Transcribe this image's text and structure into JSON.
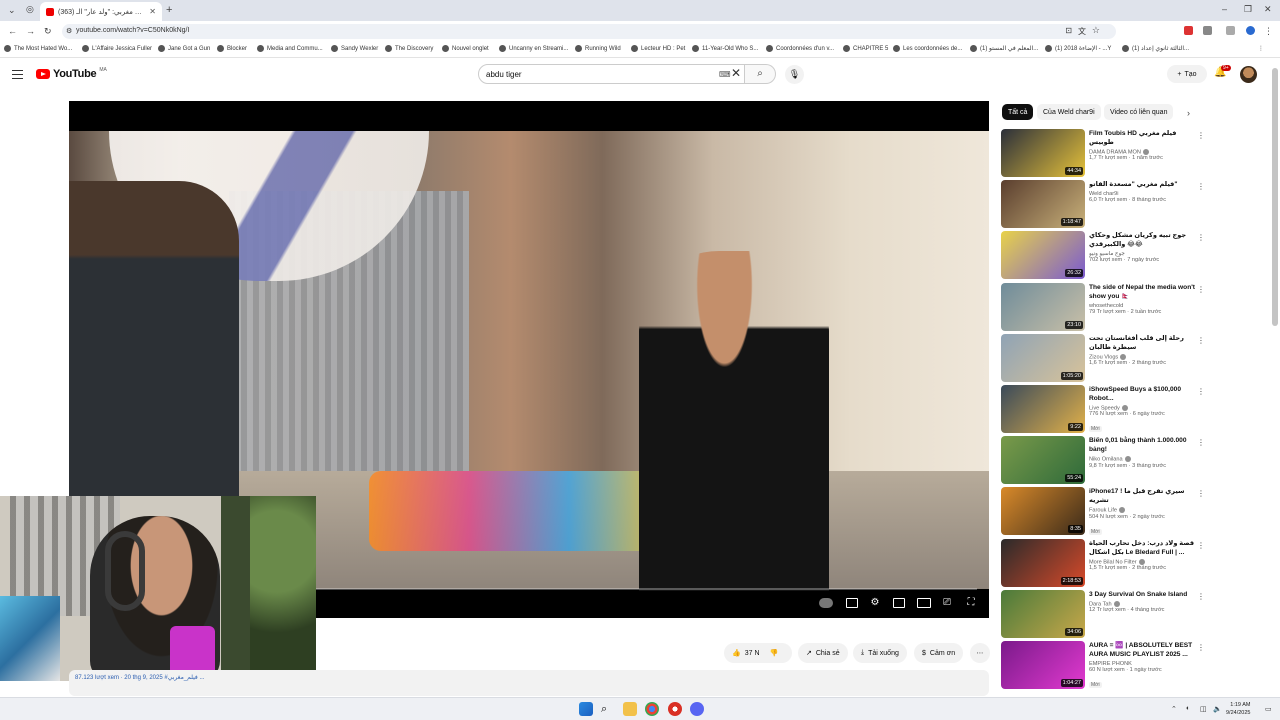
{
  "browser": {
    "tab_title": "(363) فيلم مغربي: \"ولد عار\" الـ...",
    "new_tab_symbol": "+",
    "url": "youtube.com/watch?v=C50Nk0kNg/I",
    "bookmarks": [
      "The Most Hated Wo...",
      "L'Affaire Jessica Fuller",
      "Jane Got a Gun",
      "Blocker",
      "Media and Commu...",
      "Sandy Wexler",
      "The Discovery",
      "Nouvel onglet",
      "Uncanny en Streami...",
      "Running Wild",
      "Lecteur HD : Pet",
      "11-Year-Old Who S...",
      "Coordonnées d'un v...",
      "CHAPITRE 5",
      "Les coordonnées de...",
      "(1) المعلم في المستو...",
      "(1) الإضاءة 2018 - ...Y",
      "(1) الثالثة ثانوي إعداد..."
    ]
  },
  "youtube": {
    "logo_text": "YouTube",
    "logo_country": "MA",
    "search_value": "abdu tiger",
    "create_label": "Tạo",
    "notifications_badge": "9+"
  },
  "player": {
    "progress": 0.22
  },
  "actions": {
    "likes": "37 N",
    "share": "Chia sẻ",
    "download": "Tải xuống",
    "thanks": "Cảm ơn"
  },
  "meta_strip": "87.123 lượt xem · 20 thg 9, 2025 #فيلم_مغربي ...",
  "chips": [
    "Tất cả",
    "Của Weld char9i",
    "Video có liên quan"
  ],
  "recommendations": [
    {
      "title": "Film Toubis HD فيلم مغربي طوبيس",
      "channel": "DAMA DRAMA MON",
      "verified": true,
      "stats": "1,7 Tr lượt xem · 1 năm trước",
      "duration": "44:34",
      "badge": "",
      "colors": [
        "#2b2f3a",
        "#e6c23a"
      ]
    },
    {
      "title": "فيلم مغربي \"مسعدة الفاتو\"",
      "channel": "Weld char9i",
      "verified": false,
      "stats": "6,0 Tr lượt xem · 8 tháng trước",
      "duration": "1:18:47",
      "badge": "",
      "colors": [
        "#5a3e2e",
        "#c9b17a"
      ]
    },
    {
      "title": "جوج تبيه وكريان مشكل وحكاي والكبيرقدي 😂😂",
      "channel": "جوج ماسيو ونيو",
      "verified": false,
      "stats": "702 lượt xem · 7 ngày trước",
      "duration": "26:32",
      "badge": "",
      "colors": [
        "#e8d24a",
        "#7a5ad0"
      ]
    },
    {
      "title": "The side of Nepal the media won't show you 🇳🇵",
      "channel": "whosethecold",
      "verified": false,
      "stats": "79 Tr lượt xem · 2 tuần trước",
      "duration": "23:10",
      "badge": "",
      "colors": [
        "#6f8c9a",
        "#c9c0a8"
      ]
    },
    {
      "title": "رحلة إلى قلب أفغانستان تحت سيطرة طالبان",
      "channel": "Zizou Vlogs",
      "verified": true,
      "stats": "1,6 Tr lượt xem · 2 tháng trước",
      "duration": "1:05:20",
      "badge": "",
      "colors": [
        "#8fa3b5",
        "#d8c39a"
      ]
    },
    {
      "title": "iShowSpeed Buys a $100,000 Robot...",
      "channel": "Live Speedy",
      "verified": true,
      "stats": "776 N lượt xem · 6 ngày trước",
      "duration": "9:22",
      "badge": "Mới",
      "colors": [
        "#3a4a5a",
        "#e2b14a"
      ]
    },
    {
      "title": "Biến 0,01 bằng thành 1.000.000 bảng!",
      "channel": "Niko Omilana",
      "verified": true,
      "stats": "9,8 Tr lượt xem · 3 tháng trước",
      "duration": "55:24",
      "badge": "",
      "colors": [
        "#7a9a4a",
        "#2e6a3a"
      ]
    },
    {
      "title": "iPhone17 ! سيري تفرج قبل ما تشريه",
      "channel": "Farouk Life",
      "verified": true,
      "stats": "504 N lượt xem · 2 ngày trước",
      "duration": "8:35",
      "badge": "Mới",
      "colors": [
        "#d98a2a",
        "#3a2a1a"
      ]
    },
    {
      "title": "قصة ولاد درب: دخل تحارب الحياة بكل اشكال Le Bledard Full | ...",
      "channel": "More Bilal No Filter",
      "verified": true,
      "stats": "1,5 Tr lượt xem · 2 tháng trước",
      "duration": "2:18:53",
      "badge": "",
      "colors": [
        "#2a2a2a",
        "#d84a2a"
      ]
    },
    {
      "title": "3 Day Survival On Snake Island",
      "channel": "Dara Tah",
      "verified": true,
      "stats": "12 Tr lượt xem · 4 tháng trước",
      "duration": "34:06",
      "badge": "",
      "colors": [
        "#4a7a3a",
        "#c9a84a"
      ]
    },
    {
      "title": "AURA = ♾️ | ABSOLUTELY BEST AURA MUSIC PLAYLIST 2025 ...",
      "channel": "EMPIRE PHONK",
      "verified": false,
      "stats": "60 N lượt xem · 1 ngày trước",
      "duration": "1:04:27",
      "badge": "Mới",
      "colors": [
        "#7a1a8a",
        "#e23ad0"
      ]
    }
  ],
  "taskbar": {
    "time": "1:19 AM",
    "date": "9/24/2025"
  }
}
